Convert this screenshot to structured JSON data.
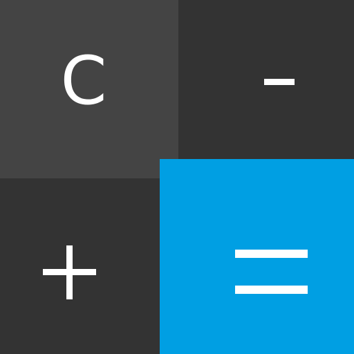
{
  "app": {
    "accent_color": "#009fe3"
  },
  "keys": {
    "clear_label": "C",
    "minus_label": "-",
    "plus_label": "+",
    "equals_label": "="
  },
  "icons": {
    "minus": "minus-icon",
    "plus": "plus-icon",
    "equals": "equals-icon"
  }
}
